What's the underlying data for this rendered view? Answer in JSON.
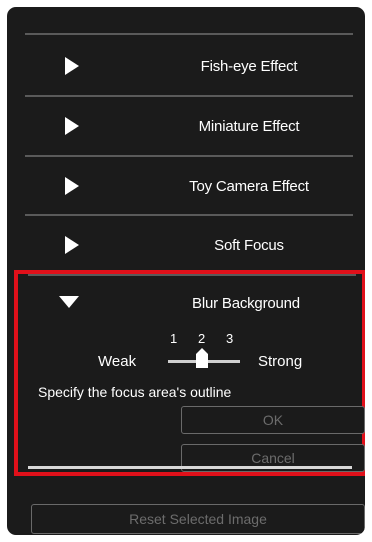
{
  "effects": [
    {
      "label": "Fish-eye Effect"
    },
    {
      "label": "Miniature Effect"
    },
    {
      "label": "Toy Camera Effect"
    },
    {
      "label": "Soft Focus"
    }
  ],
  "blur_background": {
    "label": "Blur Background",
    "slider": {
      "min_label": "Weak",
      "max_label": "Strong",
      "ticks": [
        "1",
        "2",
        "3"
      ],
      "value": 2
    },
    "instruction": "Specify the focus area's outline",
    "ok_label": "OK",
    "cancel_label": "Cancel"
  },
  "reset_label": "Reset Selected Image",
  "colors": {
    "panel_bg": "#1b1b1b",
    "highlight_border": "#e0101a",
    "text": "#ffffff",
    "disabled_text": "#6c6c6c"
  }
}
